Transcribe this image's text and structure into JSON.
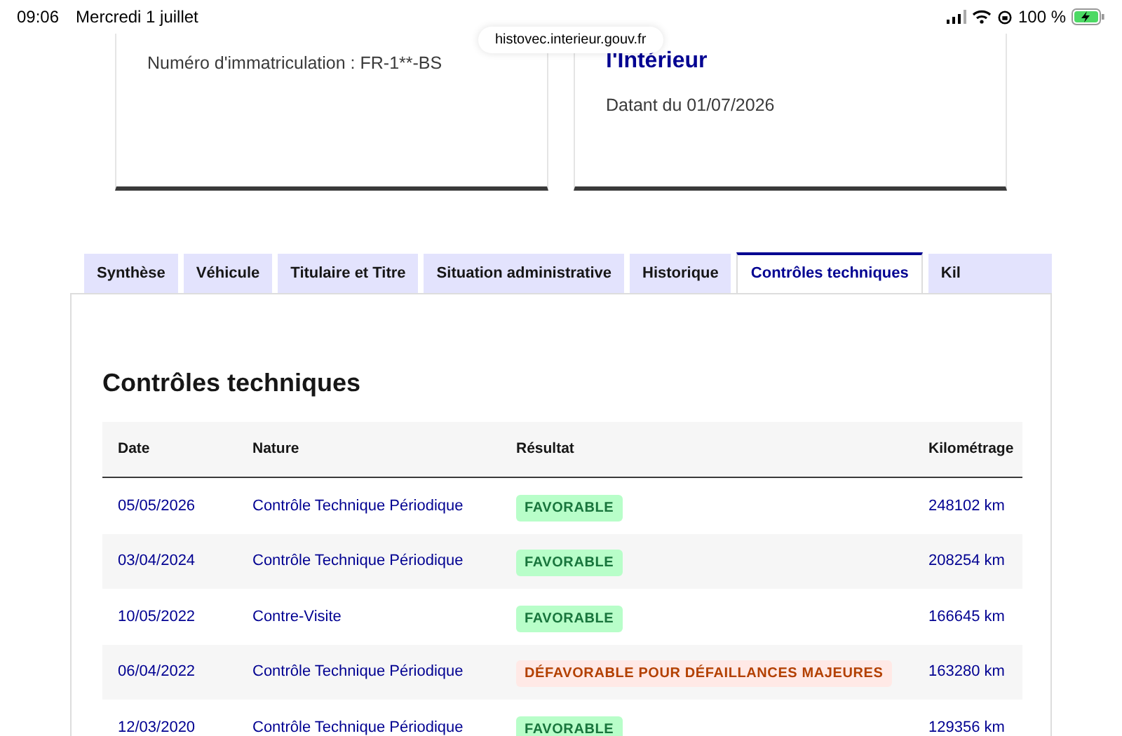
{
  "status_bar": {
    "time": "09:06",
    "date": "Mercredi 1 juillet",
    "battery": "100 %"
  },
  "address_bar": {
    "url": "histovec.interieur.gouv.fr"
  },
  "cards": [
    {
      "lines": [
        {
          "kind": "text",
          "text": "Numéro d'immatriculation : FR-1**-BS"
        }
      ]
    },
    {
      "lines": [
        {
          "kind": "title",
          "text": "l'Intérieur"
        },
        {
          "kind": "text",
          "text": "Datant du 01/07/2026"
        }
      ]
    }
  ],
  "tabs": [
    {
      "label": "Synthèse",
      "selected": false
    },
    {
      "label": "Véhicule",
      "selected": false
    },
    {
      "label": "Titulaire et Titre",
      "selected": false
    },
    {
      "label": "Situation administrative",
      "selected": false
    },
    {
      "label": "Historique",
      "selected": false
    },
    {
      "label": "Contrôles techniques",
      "selected": true
    },
    {
      "label": "Kil",
      "selected": false
    }
  ],
  "section_title": "Contrôles techniques",
  "table": {
    "columns": [
      "Date",
      "Nature",
      "Résultat",
      "Kilométrage"
    ],
    "rows": [
      {
        "date": "05/05/2026",
        "nature": "Contrôle Technique Périodique",
        "result": {
          "text": "FAVORABLE",
          "kind": "success"
        },
        "mileage": "248102 km"
      },
      {
        "date": "03/04/2024",
        "nature": "Contrôle Technique Périodique",
        "result": {
          "text": "FAVORABLE",
          "kind": "success"
        },
        "mileage": "208254 km"
      },
      {
        "date": "10/05/2022",
        "nature": "Contre-Visite",
        "result": {
          "text": "FAVORABLE",
          "kind": "success"
        },
        "mileage": "166645 km"
      },
      {
        "date": "06/04/2022",
        "nature": "Contrôle Technique Périodique",
        "result": {
          "text": "DÉFAVORABLE POUR DÉFAILLANCES MAJEURES",
          "kind": "error"
        },
        "mileage": "163280 km"
      },
      {
        "date": "12/03/2020",
        "nature": "Contrôle Technique Périodique",
        "result": {
          "text": "FAVORABLE",
          "kind": "success"
        },
        "mileage": "129356 km"
      }
    ]
  }
}
